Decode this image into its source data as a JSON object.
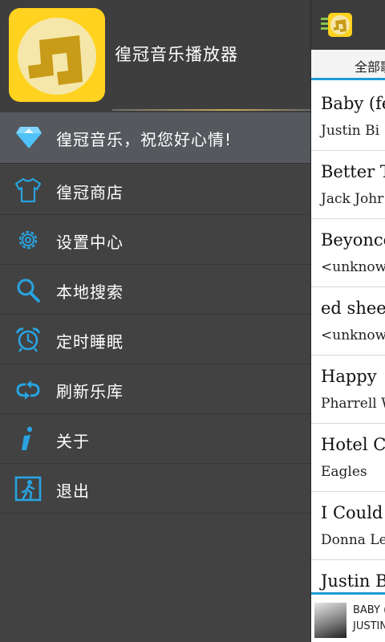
{
  "app": {
    "name": "徨冠音乐播放器"
  },
  "drawer": {
    "greeting": "徨冠音乐，祝您好心情!",
    "items": [
      {
        "label": "徨冠商店",
        "icon": "tshirt-icon"
      },
      {
        "label": "设置中心",
        "icon": "gear-icon"
      },
      {
        "label": "本地搜索",
        "icon": "search-icon"
      },
      {
        "label": "定时睡眠",
        "icon": "alarm-clock-icon"
      },
      {
        "label": "刷新乐库",
        "icon": "refresh-icon"
      },
      {
        "label": "关于",
        "icon": "info-icon"
      },
      {
        "label": "退出",
        "icon": "exit-icon"
      }
    ]
  },
  "main": {
    "tab_label": "全部歌",
    "songs": [
      {
        "title": "Baby (fe",
        "artist": "Justin Bi"
      },
      {
        "title": "Better T",
        "artist": "Jack Johr"
      },
      {
        "title": "Beyonce",
        "artist": "<unknow"
      },
      {
        "title": "ed shee",
        "artist": "<unknow"
      },
      {
        "title": "Happy",
        "artist": "Pharrell W"
      },
      {
        "title": "Hotel Ca",
        "artist": "Eagles"
      },
      {
        "title": "I Could N",
        "artist": "Donna Le"
      },
      {
        "title": "Justin B",
        "artist": ""
      }
    ],
    "now_playing": {
      "title": "BABY (",
      "artist": "JUSTIN"
    }
  },
  "colors": {
    "accent": "#1e9ad6",
    "brand": "#ffd21f",
    "drawer_bg": "#424242"
  }
}
